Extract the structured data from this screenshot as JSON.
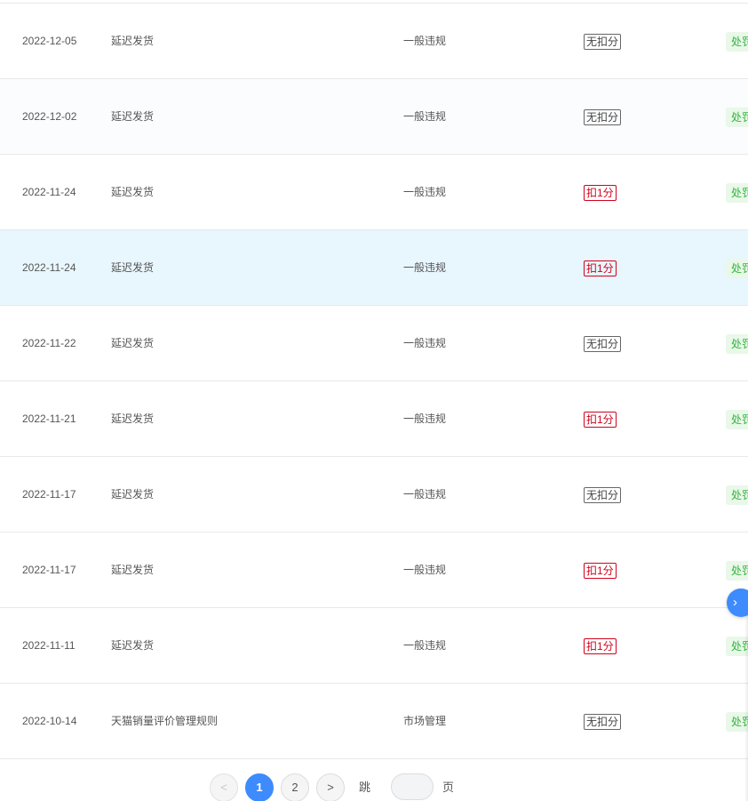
{
  "table": {
    "rows": [
      {
        "date": "2022-12-05",
        "type": "延迟发货",
        "category": "一般违规",
        "score": "无扣分",
        "score_style": "neutral",
        "status": "处罚"
      },
      {
        "date": "2022-12-02",
        "type": "延迟发货",
        "category": "一般违规",
        "score": "无扣分",
        "score_style": "neutral",
        "status": "处罚"
      },
      {
        "date": "2022-11-24",
        "type": "延迟发货",
        "category": "一般违规",
        "score": "扣1分",
        "score_style": "red",
        "status": "处罚"
      },
      {
        "date": "2022-11-24",
        "type": "延迟发货",
        "category": "一般违规",
        "score": "扣1分",
        "score_style": "red",
        "status": "处罚"
      },
      {
        "date": "2022-11-22",
        "type": "延迟发货",
        "category": "一般违规",
        "score": "无扣分",
        "score_style": "neutral",
        "status": "处罚"
      },
      {
        "date": "2022-11-21",
        "type": "延迟发货",
        "category": "一般违规",
        "score": "扣1分",
        "score_style": "red",
        "status": "处罚"
      },
      {
        "date": "2022-11-17",
        "type": "延迟发货",
        "category": "一般违规",
        "score": "无扣分",
        "score_style": "neutral",
        "status": "处罚"
      },
      {
        "date": "2022-11-17",
        "type": "延迟发货",
        "category": "一般违规",
        "score": "扣1分",
        "score_style": "red",
        "status": "处罚"
      },
      {
        "date": "2022-11-11",
        "type": "延迟发货",
        "category": "一般违规",
        "score": "扣1分",
        "score_style": "red",
        "status": "处罚"
      },
      {
        "date": "2022-10-14",
        "type": "天猫销量评价管理规则",
        "category": "市场管理",
        "score": "无扣分",
        "score_style": "neutral",
        "status": "处罚"
      }
    ]
  },
  "colors": {
    "accent": "#3d8bfd",
    "penalty_red": "#d0021b",
    "status_green": "#34b340",
    "highlight_row": "#e8f6fd"
  },
  "side_button": {
    "icon": "chevron-right-icon",
    "glyph": "›"
  },
  "pagination": {
    "prev_glyph": "<",
    "next_glyph": ">",
    "pages": [
      "1",
      "2"
    ],
    "current_page": "1",
    "jump_label": "跳至",
    "jump_value": "",
    "page_suffix": "页"
  }
}
